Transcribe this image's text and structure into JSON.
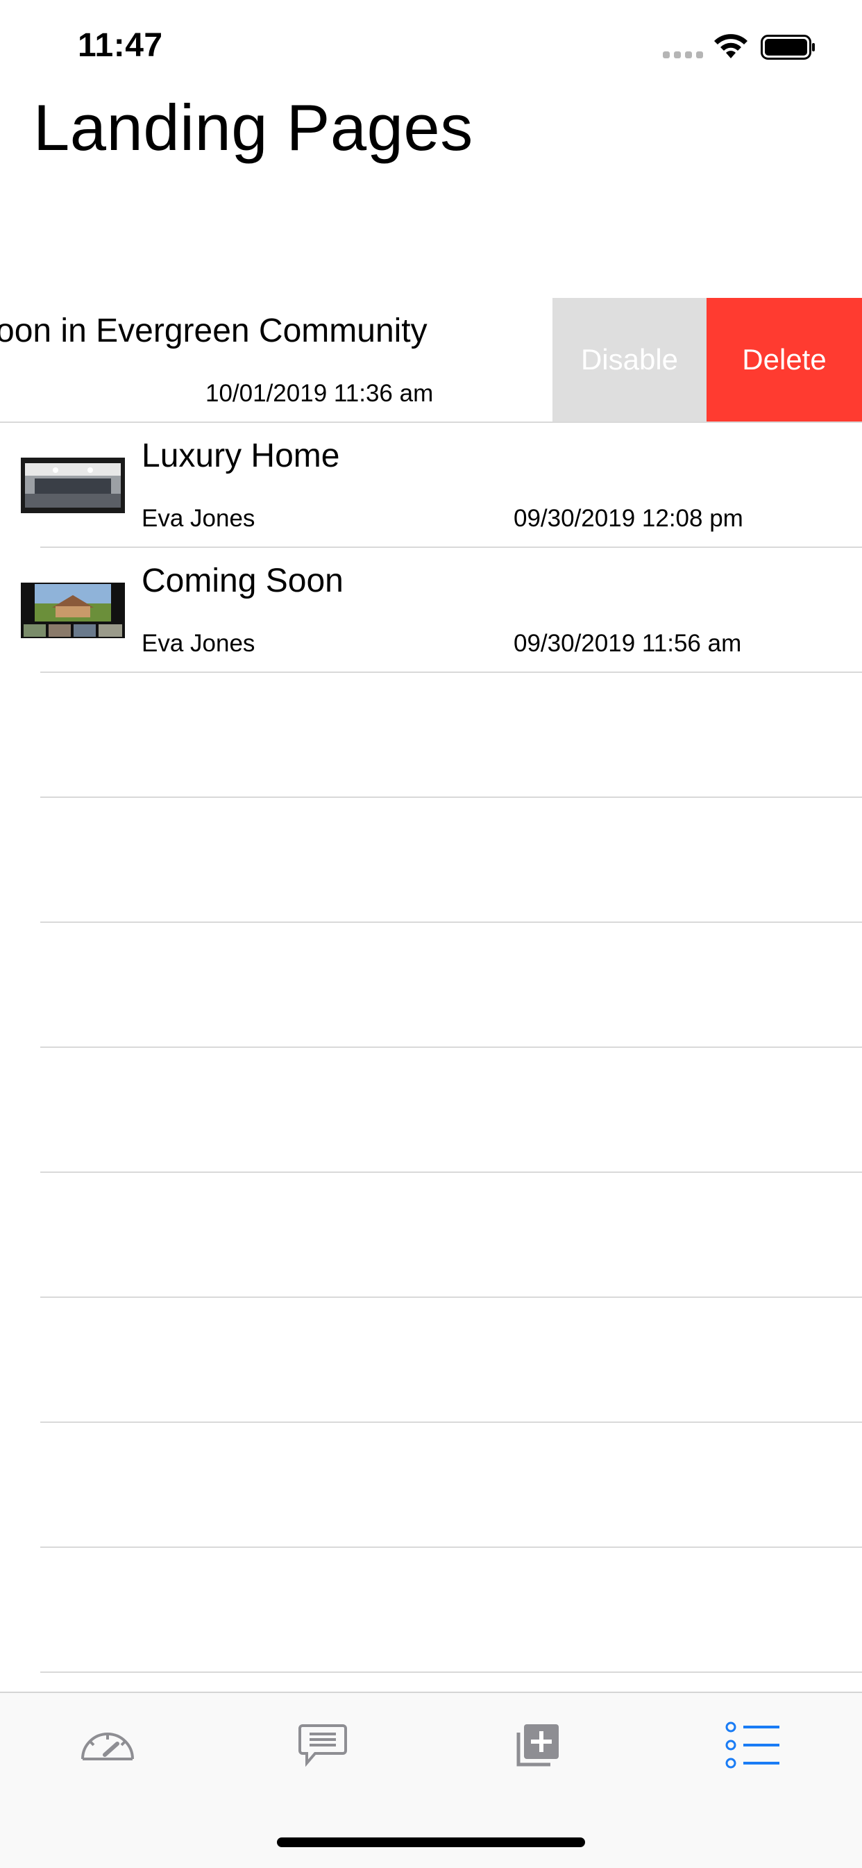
{
  "status_bar": {
    "time": "11:47"
  },
  "title": "Landing Pages",
  "rows": [
    {
      "title": "oon in Evergreen Community",
      "date": "10/01/2019 11:36 am"
    },
    {
      "title": "Luxury Home",
      "author": "Eva Jones",
      "date": "09/30/2019 12:08 pm"
    },
    {
      "title": "Coming Soon",
      "author": "Eva Jones",
      "date": "09/30/2019 11:56 am"
    }
  ],
  "swipe_actions": {
    "disable": "Disable",
    "delete": "Delete"
  },
  "tabbar": {
    "tabs": [
      {
        "name": "dashboard-icon",
        "active": false
      },
      {
        "name": "messages-icon",
        "active": false
      },
      {
        "name": "add-page-icon",
        "active": false
      },
      {
        "name": "list-icon",
        "active": true
      }
    ],
    "active_color": "#1a7cf5",
    "inactive_color": "#8e8e93"
  },
  "colors": {
    "delete": "#ff3b30",
    "disable": "#dedede"
  }
}
